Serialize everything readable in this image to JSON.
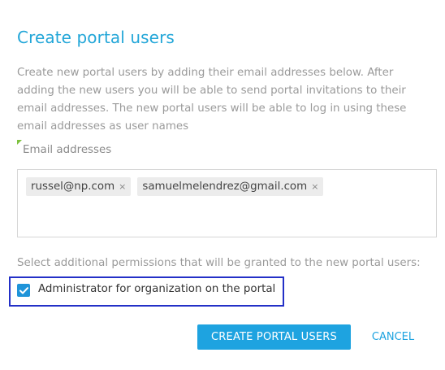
{
  "dialog": {
    "title": "Create portal users",
    "description": "Create new portal users by adding their email addresses below. After adding the new users you will be able to send portal invitations to their email addresses. The new portal users will be able to log in using these email addresses as user names",
    "email_label": "Email addresses",
    "emails": [
      "russel@np.com",
      "samuelmelendrez@gmail.com"
    ],
    "tag_remove_symbol": "×",
    "permissions_note": "Select additional permissions that will be granted to the new portal users:",
    "admin_checkbox": {
      "label": "Administrator for organization on the portal",
      "checked": true
    },
    "buttons": {
      "create": "CREATE PORTAL USERS",
      "cancel": "CANCEL"
    }
  },
  "colors": {
    "accent": "#1ea3e0",
    "title": "#22a6d8",
    "required_marker": "#7dc13e",
    "highlight_border": "#2330c7"
  },
  "icons": {
    "checkbox": "checkmark-icon",
    "required": "required-marker-icon",
    "tag_remove": "close-icon"
  }
}
